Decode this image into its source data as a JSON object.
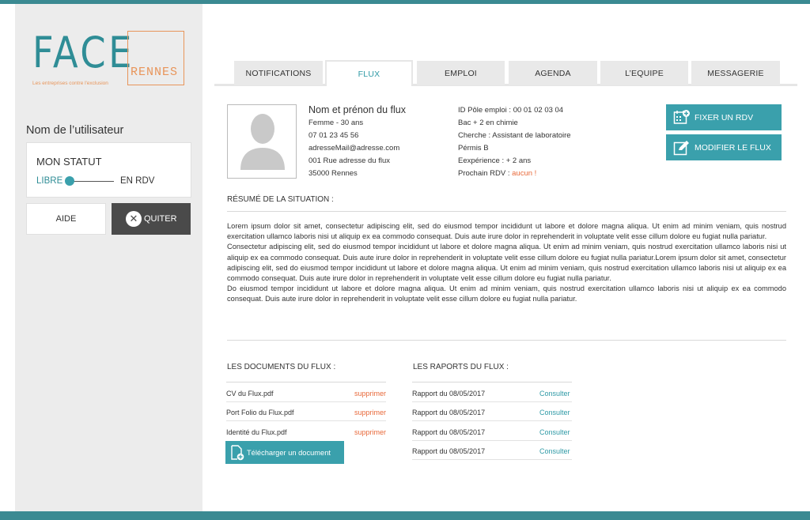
{
  "logo": {
    "brand": "FACE",
    "city": "RENNES",
    "tagline": "Les entreprises contre l'exclusion"
  },
  "sidebar": {
    "username": "Nom de l’utilisateur",
    "status_title": "MON STATUT",
    "status_left": "LIBRE",
    "status_right": "EN RDV",
    "help_label": "AIDE",
    "quit_label": "QUITER"
  },
  "tabs": [
    "NOTIFICATIONS",
    "FLUX",
    "EMPLOI",
    "AGENDA",
    "L’EQUIPE",
    "MESSAGERIE"
  ],
  "active_tab": "FLUX",
  "profile": {
    "name": "Nom et prénon du flux",
    "gender_age": "Femme - 30 ans",
    "phone": "07 01 23 45 56",
    "email": "adresseMail@adresse.com",
    "address": "001 Rue adresse du flux",
    "city": "35000 Rennes",
    "pole_emploi": "ID Pôle emploi : 00 01 02 03 04",
    "diploma": "Bac + 2  en chimie",
    "search": "Cherche : Assistant de laboratoire",
    "license": "Pérmis B",
    "experience": "Eexpérience : + 2 ans",
    "next_rdv_label": "Prochain RDV :",
    "next_rdv_value": "aucun !"
  },
  "actions": {
    "fix_rdv": "FIXER UN RDV",
    "edit_flux": "MODIFIER LE FLUX"
  },
  "summary": {
    "title": "RÉSUMÉ DE LA SITUATION :",
    "text": "Lorem ipsum dolor sit amet, consectetur adipiscing elit, sed do eiusmod tempor incididunt ut labore et dolore magna aliqua. Ut enim ad minim veniam, quis nostrud exercitation ullamco laboris nisi ut aliquip ex ea commodo consequat. Duis aute irure dolor in reprehenderit in voluptate velit esse cillum dolore eu fugiat nulla pariatur.\nConsectetur adipiscing elit, sed do eiusmod tempor incididunt ut labore et dolore magna aliqua. Ut enim ad minim veniam, quis nostrud exercitation ullamco laboris nisi ut aliquip ex ea commodo consequat. Duis aute irure dolor in reprehenderit in voluptate velit esse cillum dolore eu fugiat nulla pariatur.Lorem ipsum dolor sit amet, consectetur adipiscing elit, sed do eiusmod tempor incididunt ut labore et dolore magna aliqua. Ut enim ad minim veniam, quis nostrud exercitation ullamco laboris nisi ut aliquip ex ea commodo consequat. Duis aute irure dolor in reprehenderit in voluptate velit esse cillum dolore eu fugiat nulla pariatur.\nDo eiusmod tempor incididunt ut labore et dolore magna aliqua. Ut enim ad minim veniam, quis nostrud exercitation ullamco laboris nisi ut aliquip ex ea commodo consequat. Duis aute irure dolor in reprehenderit in voluptate velit esse cillum dolore eu fugiat nulla pariatur."
  },
  "documents": {
    "title": "LES DOCUMENTS DU FLUX :",
    "items": [
      {
        "name": "CV du Flux.pdf",
        "action": "supprimer"
      },
      {
        "name": "Port Folio du Flux.pdf",
        "action": "supprimer"
      },
      {
        "name": "Identité du Flux.pdf",
        "action": "supprimer"
      }
    ],
    "upload_label": "Télécharger un document"
  },
  "reports": {
    "title": "LES RAPORTS DU FLUX :",
    "items": [
      {
        "name": "Rapport du 08/05/2017",
        "action": "Consulter"
      },
      {
        "name": "Rapport du 08/05/2017",
        "action": "Consulter"
      },
      {
        "name": "Rapport du 08/05/2017",
        "action": "Consulter"
      },
      {
        "name": "Rapport du 08/05/2017",
        "action": "Consulter"
      }
    ]
  },
  "colors": {
    "accent": "#3aa0ac",
    "brand_teal": "#2f8d96",
    "orange": "#e8693a",
    "dark_button": "#4a4a4a"
  }
}
